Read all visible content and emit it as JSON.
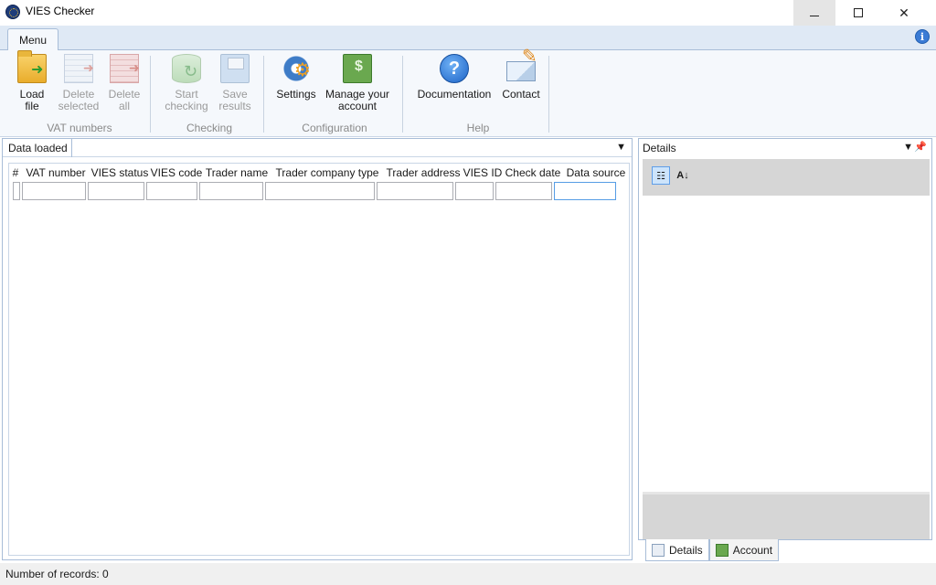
{
  "window": {
    "title": "VIES Checker"
  },
  "ribbon": {
    "tab": "Menu",
    "groups": [
      {
        "label": "VAT numbers",
        "buttons": [
          {
            "line1": "Load",
            "line2": "file",
            "icon": "folder-open-icon"
          },
          {
            "line1": "Delete",
            "line2": "selected",
            "icon": "table-delete-icon"
          },
          {
            "line1": "Delete",
            "line2": "all",
            "icon": "table-delete-all-icon"
          }
        ]
      },
      {
        "label": "Checking",
        "buttons": [
          {
            "line1": "Start",
            "line2": "checking",
            "icon": "database-refresh-icon"
          },
          {
            "line1": "Save",
            "line2": "results",
            "icon": "save-icon"
          }
        ]
      },
      {
        "label": "Configuration",
        "buttons": [
          {
            "line1": "Settings",
            "line2": "",
            "icon": "gear-icon"
          },
          {
            "line1": "Manage your",
            "line2": "account",
            "icon": "money-icon"
          }
        ]
      },
      {
        "label": "Help",
        "buttons": [
          {
            "line1": "Documentation",
            "line2": "",
            "icon": "help-icon"
          },
          {
            "line1": "Contact",
            "line2": "",
            "icon": "mail-icon"
          }
        ]
      }
    ]
  },
  "data_panel": {
    "tab": "Data loaded",
    "columns": [
      "#",
      "VAT number",
      "VIES status",
      "VIES code",
      "Trader name",
      "Trader company type",
      "Trader address",
      "VIES ID",
      "Check date",
      "Data source"
    ]
  },
  "details_panel": {
    "title": "Details",
    "tabs": [
      "Details",
      "Account"
    ]
  },
  "status": {
    "text": "Number of records: 0"
  }
}
